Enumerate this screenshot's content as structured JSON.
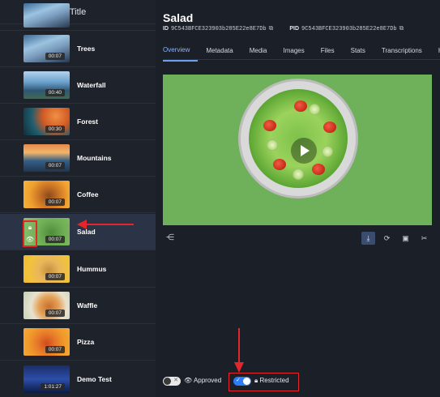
{
  "left_panel": {
    "header": "Title",
    "rows": [
      {
        "title": "Trees",
        "duration": "00:07"
      },
      {
        "title": "Waterfall",
        "duration": "00:40"
      },
      {
        "title": "Forest",
        "duration": "00:30"
      },
      {
        "title": "Mountains",
        "duration": "00:07"
      },
      {
        "title": "Coffee",
        "duration": "00:07"
      },
      {
        "title": "Salad",
        "duration": "00:07"
      },
      {
        "title": "Hummus",
        "duration": "00:07"
      },
      {
        "title": "Waffle",
        "duration": "00:07"
      },
      {
        "title": "Pizza",
        "duration": "00:07"
      },
      {
        "title": "Demo Test",
        "duration": "1:01:27"
      }
    ]
  },
  "detail": {
    "title": "Salad",
    "id_label": "ID",
    "id_value": "9C543BFCE323903b285E22e8E7Db",
    "pid_label": "PID",
    "pid_value": "9C543BFCE323903b285E22e8E7Db",
    "tabs": [
      "Overview",
      "Metadata",
      "Media",
      "Images",
      "Files",
      "Stats",
      "Transcriptions",
      "Hi"
    ],
    "approved_label": "Approved",
    "restricted_label": "Restricted"
  },
  "colors": {
    "accent": "#2f7cf6",
    "annotation_red": "#e3262c",
    "selected_row": "#2b3447"
  },
  "icons": [
    "lock-icon",
    "eye-icon",
    "share-icon",
    "download-icon",
    "refresh-icon",
    "image-icon",
    "scissors-icon",
    "copy-icon",
    "play-icon",
    "check-icon",
    "x-icon"
  ]
}
